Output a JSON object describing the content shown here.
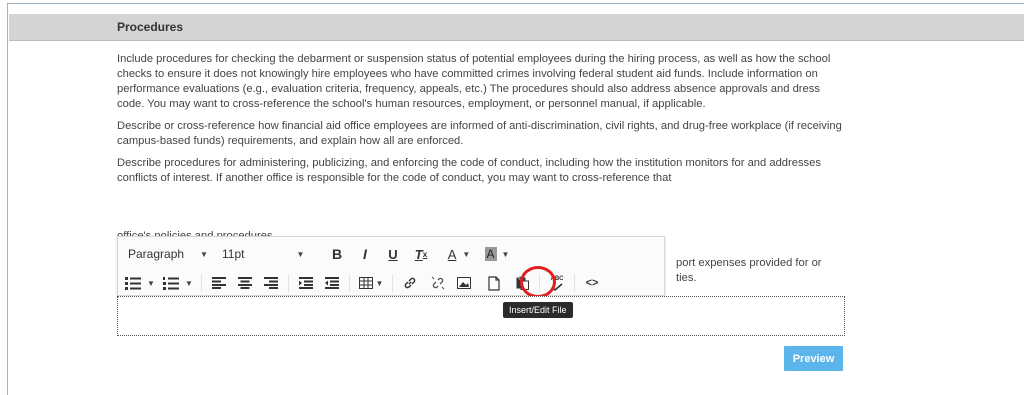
{
  "section": {
    "title": "Procedures"
  },
  "content": {
    "paragraphs": [
      "Include procedures for checking the debarment or suspension status of potential employees during the hiring process, as well as how the school checks to ensure it does not knowingly hire employees who have committed crimes involving federal student aid funds. Include information on performance evaluations (e.g., evaluation criteria, frequency, appeals, etc.) The procedures should also address absence approvals and dress code. You may want to cross-reference the school's human resources, employment, or personnel manual, if applicable.",
      "Describe or cross-reference how financial aid office employees are informed of anti-discrimination, civil rights, and drug-free workplace (if receiving campus-based funds) requirements, and explain how all are enforced.",
      "Describe procedures for administering, publicizing, and enforcing the code of conduct, including how the institution monitors for and addresses conflicts of interest. If another office is responsible for the code of conduct, you may want to cross-reference that"
    ],
    "partial_line": "office's policies and procedures.",
    "behind_toolbar_line1": "port expenses provided for or",
    "behind_toolbar_line2": "ties."
  },
  "toolbar": {
    "format_select": "Paragraph",
    "font_size_select": "11pt",
    "bold_label": "B",
    "italic_label": "I",
    "underline_label": "U",
    "clear_format_label": "T",
    "text_color_label": "A",
    "bg_color_label": "A",
    "code_label": "<>",
    "spellcheck_label": "ABC"
  },
  "tooltip": "Insert/Edit File",
  "preview_button": "Preview",
  "colors": {
    "accent": "#5bb4ea",
    "highlight": "#e02020",
    "header_bg": "#d4d4d4"
  }
}
